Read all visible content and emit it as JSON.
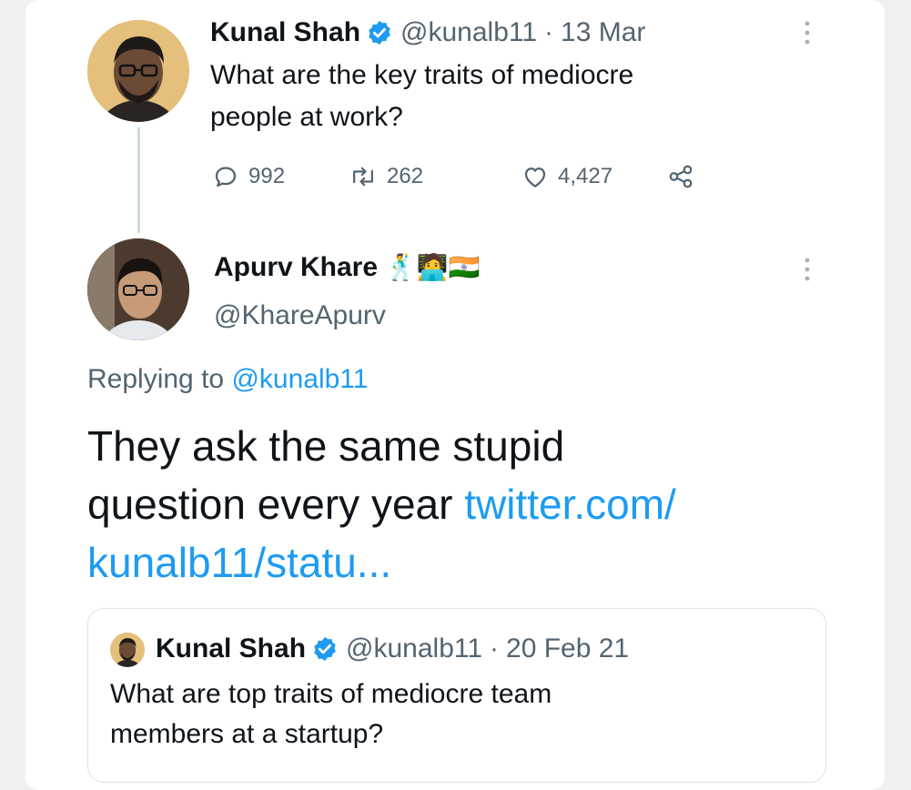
{
  "tweet": {
    "author_name": "Kunal Shah",
    "handle": "@kunalb11",
    "separator": "·",
    "date": "13 Mar",
    "text_line1": "What are the key traits of mediocre",
    "text_line2": "people at work?",
    "replies": "992",
    "retweets": "262",
    "likes": "4,427"
  },
  "reply": {
    "author_name": "Apurv Khare",
    "name_emojis": "🕺🧑‍💻🇮🇳",
    "handle": "@KhareApurv",
    "replying_prefix": "Replying to",
    "replying_mention": "@kunalb11",
    "text_line1": "They ask the same stupid",
    "text_line2": "question every year",
    "link_part1": "twitter.com/",
    "link_part2": "kunalb11/statu..."
  },
  "quoted": {
    "author_name": "Kunal Shah",
    "handle": "@kunalb11",
    "separator": "·",
    "date": "20 Feb 21",
    "text_line1": "What are top traits of mediocre team",
    "text_line2": "members at a startup?"
  },
  "colors": {
    "link": "#1d9bf0",
    "verified": "#1d9bf0",
    "secondary_text": "#536471",
    "primary_text": "#0f1419"
  },
  "icons": [
    "verified-badge-icon",
    "reply-icon",
    "retweet-icon",
    "like-icon",
    "share-icon",
    "more-options-icon"
  ]
}
